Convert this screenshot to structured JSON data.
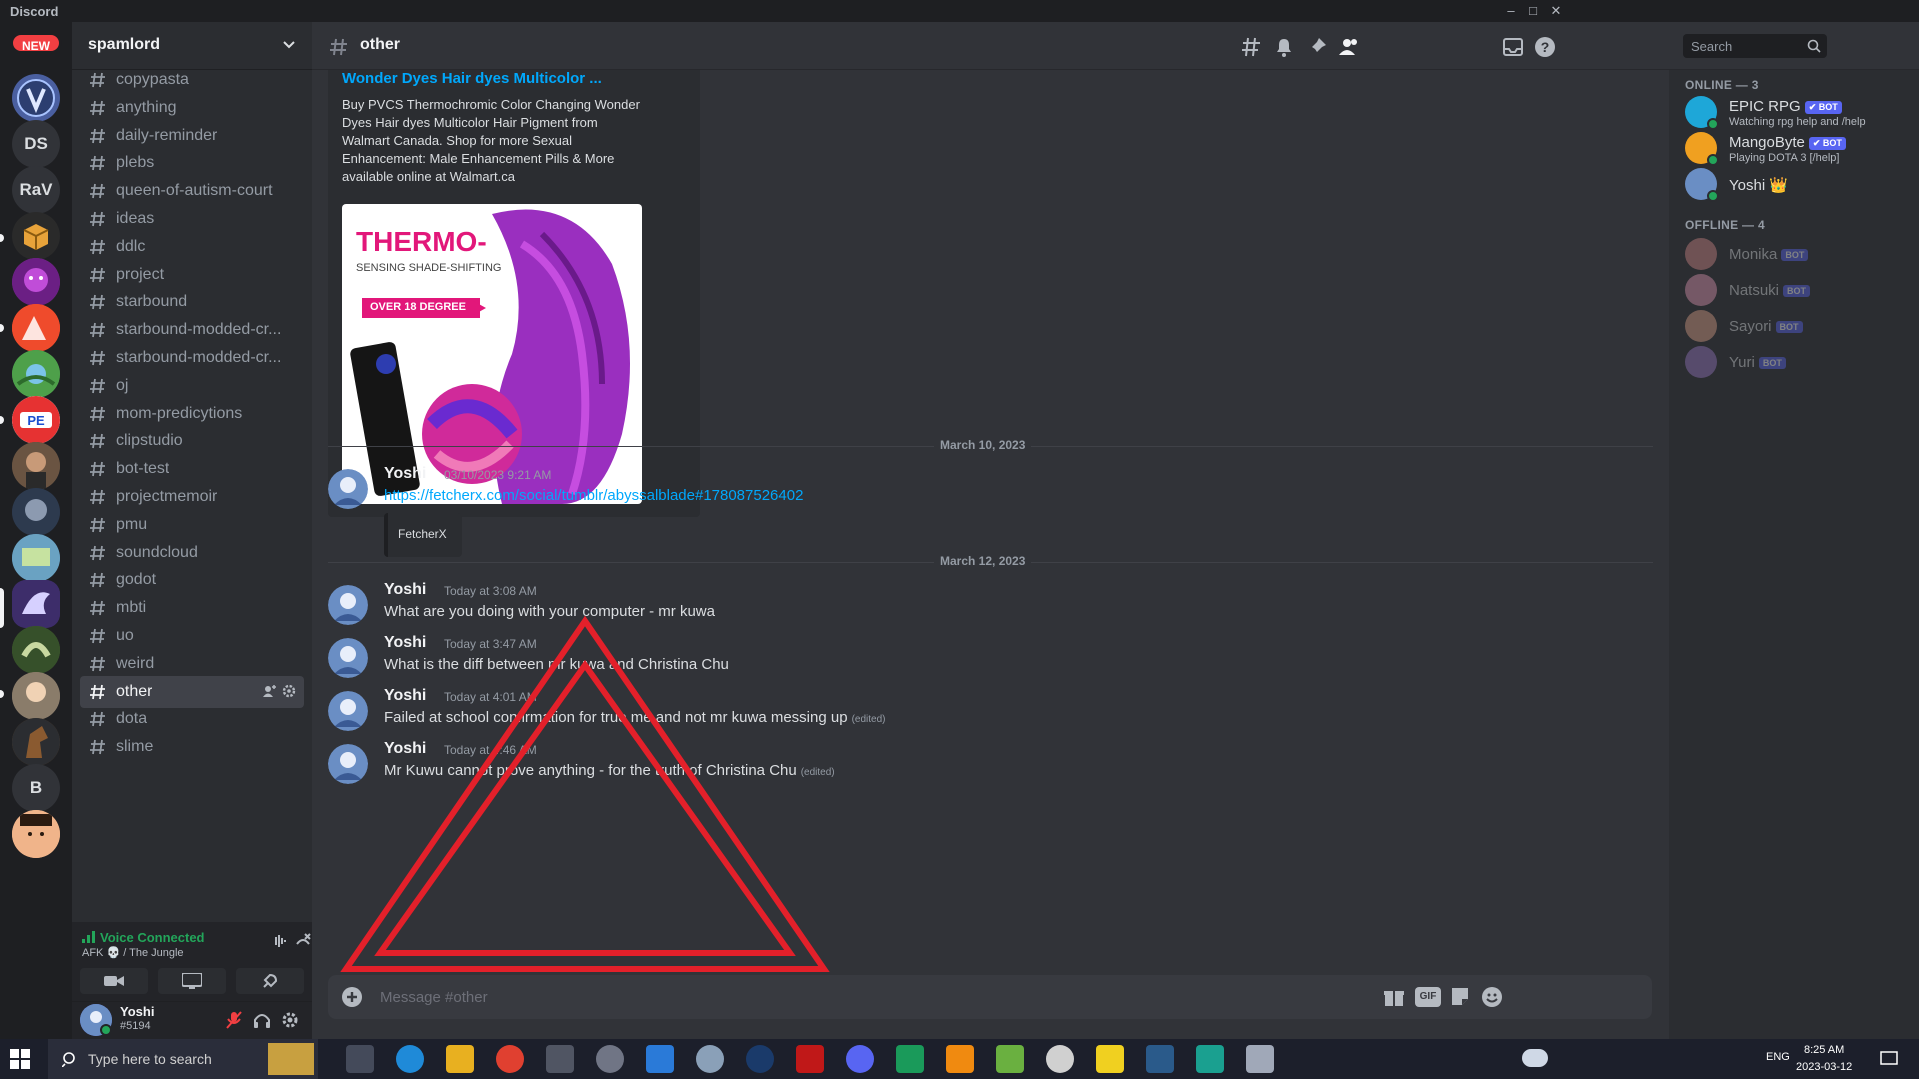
{
  "titlebar": {
    "app_name": "Discord"
  },
  "server_rail": {
    "new_badge": "NEW",
    "initials": [
      "DS",
      "RaV",
      "B"
    ]
  },
  "guild": {
    "name": "spamlord"
  },
  "channels": [
    "copypasta",
    "anything",
    "daily-reminder",
    "plebs",
    "queen-of-autism-court",
    "ideas",
    "ddlc",
    "project",
    "starbound",
    "starbound-modded-cr...",
    "starbound-modded-cr...",
    "oj",
    "mom-predicytions",
    "clipstudio",
    "bot-test",
    "projectmemoir",
    "pmu",
    "soundcloud",
    "godot",
    "mbti",
    "uo",
    "weird",
    "other",
    "dota",
    "slime"
  ],
  "active_channel": "other",
  "voice": {
    "status": "Voice Connected",
    "location": "AFK 💀 / The Jungle"
  },
  "user": {
    "name": "Yoshi",
    "tag": "#5194"
  },
  "header": {
    "channel": "other",
    "search_placeholder": "Search"
  },
  "embed": {
    "title": "Wonder Dyes Hair dyes Multicolor ...",
    "description": "Buy PVCS Thermochromic Color Changing Wonder Dyes Hair dyes Multicolor Hair Pigment from Walmart Canada. Shop for more Sexual Enhancement: Male Enhancement Pills & More available online at Walmart.ca",
    "image_text": {
      "title": "THERMO-",
      "subtitle": "SENSING SHADE-SHIFTING",
      "badge": "OVER 18 DEGREE"
    }
  },
  "dividers": [
    "March 10, 2023",
    "March 12, 2023"
  ],
  "messages": [
    {
      "author": "Yoshi",
      "time": "03/10/2023 9:21 AM",
      "link": "https://fetcherx.com/social/tumblr/abyssalblade#178087526402",
      "link_embed": "FetcherX"
    },
    {
      "author": "Yoshi",
      "time": "Today at 3:08 AM",
      "text": "What are you doing with your computer - mr kuwa",
      "edited": ""
    },
    {
      "author": "Yoshi",
      "time": "Today at 3:47 AM",
      "text": "What is the diff between mr kuwa and Christina Chu",
      "edited": ""
    },
    {
      "author": "Yoshi",
      "time": "Today at 4:01 AM",
      "text": "Failed at school confirmation for true me and not mr kuwa messing up",
      "edited": "(edited)"
    },
    {
      "author": "Yoshi",
      "time": "Today at 4:46 AM",
      "text": "Mr Kuwu cannot prove anything - for the truth of Christina Chu",
      "edited": "(edited)"
    }
  ],
  "composer": {
    "placeholder": "Message #other",
    "gif_label": "GIF"
  },
  "members": {
    "online_header": "ONLINE — 3",
    "offline_header": "OFFLINE — 4",
    "bot_label": "BOT",
    "verified_bot_label": "✔ BOT",
    "online": [
      {
        "name": "EPIC RPG",
        "bot": true,
        "activity": "Watching rpg help and /help",
        "color": "#1ea7d8"
      },
      {
        "name": "MangoByte",
        "bot": true,
        "activity": "Playing DOTA 3 [/help]",
        "color": "#f0a020"
      },
      {
        "name": "Yoshi",
        "bot": false,
        "crown": "👑",
        "activity": "",
        "color": "#6a8ec4"
      }
    ],
    "offline": [
      {
        "name": "Monika",
        "color": "#d68a8a"
      },
      {
        "name": "Natsuki",
        "color": "#e59ab5"
      },
      {
        "name": "Sayori",
        "color": "#e0a38a"
      },
      {
        "name": "Yuri",
        "color": "#9a78c6"
      }
    ]
  },
  "taskbar": {
    "search_placeholder": "Type here to search",
    "lang": "ENG",
    "time": "8:25 AM",
    "date": "2023-03-12"
  },
  "colors": {
    "accent": "#5865f2",
    "link": "#00a8fc",
    "online": "#23a55a",
    "annotation": "#e3202a"
  }
}
